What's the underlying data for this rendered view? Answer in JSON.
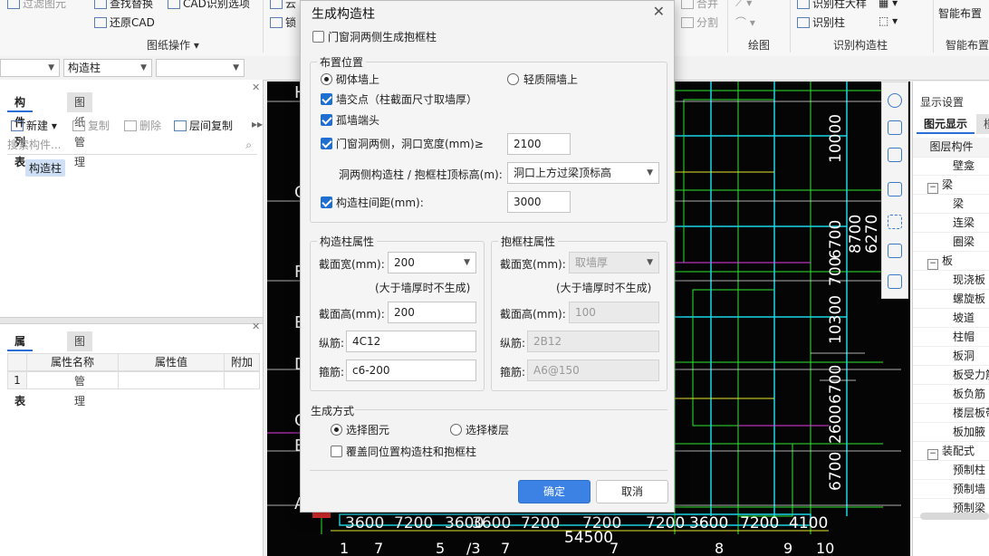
{
  "ribbon": {
    "items": {
      "filter": "过滤图元",
      "find_replace": "查找替换",
      "restore_cad": "还原CAD",
      "cad_options": "CAD识别选项",
      "lock": "锁",
      "cloud": "云",
      "merge": "合并",
      "split": "分割",
      "col_table": "识别柱大样",
      "identify_col": "识别柱"
    },
    "groups": {
      "drawing_ops": "图纸操作",
      "draw": "绘图",
      "identify_struct_col": "识别构造柱",
      "smart_layout_label": "智能布置",
      "smart_layout": "智能布置"
    }
  },
  "toolbar": {
    "combo1": "",
    "combo2": "构造柱",
    "combo3": ""
  },
  "left_panel": {
    "tabs": [
      "构件列表",
      "图纸管理"
    ],
    "buttons": {
      "new": "新建",
      "copy": "复制",
      "delete": "删除",
      "floor_copy": "层间复制"
    },
    "search_placeholder": "搜索构件...",
    "selected_item": "构造柱",
    "prop_tabs": [
      "属性列表",
      "图层管理"
    ],
    "prop_headers": [
      "属性名称",
      "属性值",
      "附加"
    ],
    "prop_row_index": "1"
  },
  "cad": {
    "dims_bottom": [
      "3600",
      "7200",
      "3600",
      "3600",
      "7200",
      "7200",
      "7200",
      "3600",
      "7200",
      "4100"
    ],
    "total": "54500",
    "axis_bottom": [
      "1",
      "7",
      "5",
      "/3",
      "7",
      "7",
      "8",
      "9",
      "10"
    ],
    "axes_left": [
      "H",
      "G",
      "F",
      "E",
      "D",
      "C",
      "B",
      "A"
    ],
    "dims_right_1": [
      "6700",
      "2600",
      "6700",
      "10300",
      "700",
      "6700",
      "10000"
    ],
    "dims_right_2": [
      "8700",
      "6270"
    ]
  },
  "right_panel": {
    "title": "显示设置",
    "tabs": [
      "图元显示",
      "楼"
    ],
    "header": "图层构件",
    "rows": [
      {
        "label": "壁龛",
        "level": 2
      },
      {
        "label": "梁",
        "level": 1,
        "expander": "−"
      },
      {
        "label": "梁",
        "level": 2
      },
      {
        "label": "连梁",
        "level": 2
      },
      {
        "label": "圈梁",
        "level": 2
      },
      {
        "label": "板",
        "level": 1,
        "expander": "−"
      },
      {
        "label": "现浇板",
        "level": 2
      },
      {
        "label": "螺旋板",
        "level": 2
      },
      {
        "label": "坡道",
        "level": 2
      },
      {
        "label": "柱帽",
        "level": 2
      },
      {
        "label": "板洞",
        "level": 2
      },
      {
        "label": "板受力筋",
        "level": 2
      },
      {
        "label": "板负筋",
        "level": 2
      },
      {
        "label": "楼层板带",
        "level": 2
      },
      {
        "label": "板加腋",
        "level": 2
      },
      {
        "label": "装配式",
        "level": 1,
        "expander": "−"
      },
      {
        "label": "预制柱",
        "level": 2
      },
      {
        "label": "预制墙",
        "level": 2
      },
      {
        "label": "预制梁",
        "level": 2
      }
    ]
  },
  "dialog": {
    "title": "生成构造柱",
    "close": "✕",
    "door_window_checkbox": "门窗洞两侧生成抱框柱",
    "placement": {
      "title": "布置位置",
      "radio_masonry": "砌体墙上",
      "radio_light": "轻质隔墙上",
      "wall_intersection": "墙交点（柱截面尺寸取墙厚）",
      "isolated_wall_end": "孤墙端头",
      "door_window_sides": "门窗洞两侧，洞口宽度(mm)≥",
      "door_window_width": "2100",
      "top_elev_label": "洞两侧构造柱 / 抱框柱顶标高(m):",
      "top_elev_value": "洞口上方过梁顶标高",
      "spacing_label": "构造柱间距(mm):",
      "spacing_value": "3000"
    },
    "struct_col": {
      "title": "构造柱属性",
      "width_label": "截面宽(mm):",
      "width_value": "200",
      "width_note": "(大于墙厚时不生成)",
      "height_label": "截面高(mm):",
      "height_value": "200",
      "long_bar_label": "纵筋:",
      "long_bar_value": "4C12",
      "stirrup_label": "箍筋:",
      "stirrup_value": "c6-200"
    },
    "frame_col": {
      "title": "抱框柱属性",
      "width_label": "截面宽(mm):",
      "width_value": "取墙厚",
      "width_note": "(大于墙厚时不生成)",
      "height_label": "截面高(mm):",
      "height_value": "100",
      "long_bar_label": "纵筋:",
      "long_bar_value": "2B12",
      "stirrup_label": "箍筋:",
      "stirrup_value": "A6@150"
    },
    "gen_mode": {
      "title": "生成方式",
      "radio_select_element": "选择图元",
      "radio_select_floor": "选择楼层",
      "overwrite": "覆盖同位置构造柱和抱框柱"
    },
    "ok": "确定",
    "cancel": "取消"
  }
}
